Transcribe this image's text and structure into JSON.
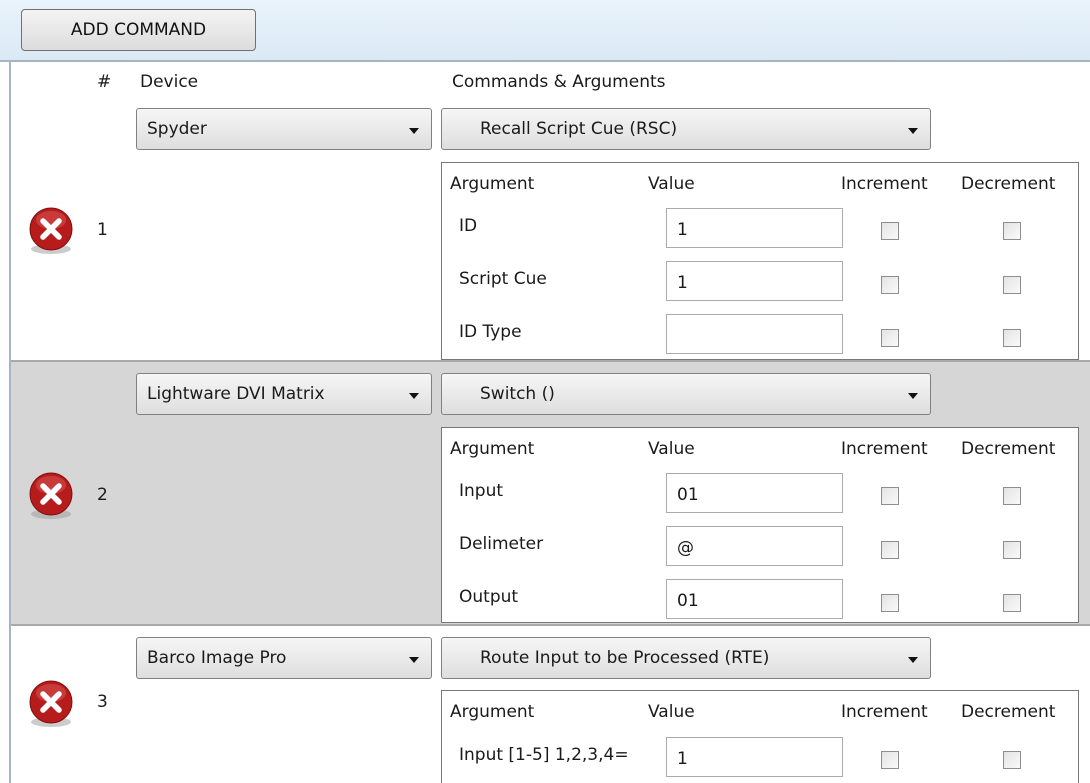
{
  "toolbar": {
    "add_command_label": "ADD COMMAND"
  },
  "columns": {
    "number": "#",
    "device": "Device",
    "commands": "Commands & Arguments"
  },
  "grid_headers": {
    "argument": "Argument",
    "value": "Value",
    "increment": "Increment",
    "decrement": "Decrement"
  },
  "icons": {
    "remove": "remove-error-icon",
    "dropdown": "chevron-down-icon"
  },
  "colors": {
    "error_red": "#b71c1c",
    "row_alt": "#d6d6d6",
    "toolbar": "#dbe9f5"
  },
  "commands": [
    {
      "number": "1",
      "device": "Spyder",
      "command": "Recall Script Cue (RSC)",
      "args": [
        {
          "name": "ID",
          "value": "1",
          "increment": false,
          "decrement": false
        },
        {
          "name": "Script Cue",
          "value": "1",
          "increment": false,
          "decrement": false
        },
        {
          "name": "ID Type",
          "value": "",
          "increment": false,
          "decrement": false
        }
      ]
    },
    {
      "number": "2",
      "device": "Lightware DVI Matrix",
      "command": "Switch ()",
      "args": [
        {
          "name": "Input",
          "value": "01",
          "increment": false,
          "decrement": false
        },
        {
          "name": "Delimeter",
          "value": "@",
          "increment": false,
          "decrement": false
        },
        {
          "name": "Output",
          "value": "01",
          "increment": false,
          "decrement": false
        }
      ]
    },
    {
      "number": "3",
      "device": "Barco Image Pro",
      "command": "Route Input to be Processed (RTE)",
      "args": [
        {
          "name": "Input [1-5] 1,2,3,4=",
          "value": "1",
          "increment": false,
          "decrement": false
        }
      ]
    }
  ]
}
